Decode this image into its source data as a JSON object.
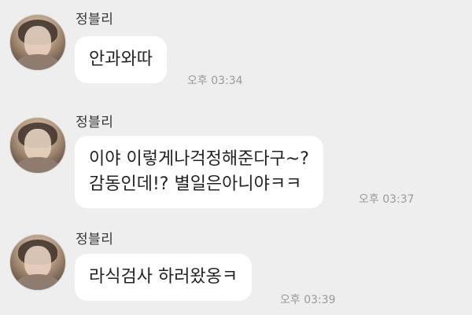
{
  "conversation": {
    "messages": [
      {
        "sender": "정블리",
        "avatar_icon": "user-avatar-icon",
        "lines": [
          "안과와따"
        ],
        "time": "오후 03:34"
      },
      {
        "sender": "정블리",
        "avatar_icon": "user-avatar-icon",
        "lines": [
          "이야 이렇게나걱정해준다구~?",
          "감동인데!? 별일은아니야ㅋㅋ"
        ],
        "time": "오후 03:37"
      },
      {
        "sender": "정블리",
        "avatar_icon": "user-avatar-icon",
        "lines": [
          "라식검사 하러왔옹ㅋ"
        ],
        "time": "오후 03:39"
      }
    ]
  },
  "colors": {
    "background": "#eeeeee",
    "bubble": "#ffffff",
    "text": "#222222",
    "timestamp": "#9a9a9a"
  }
}
